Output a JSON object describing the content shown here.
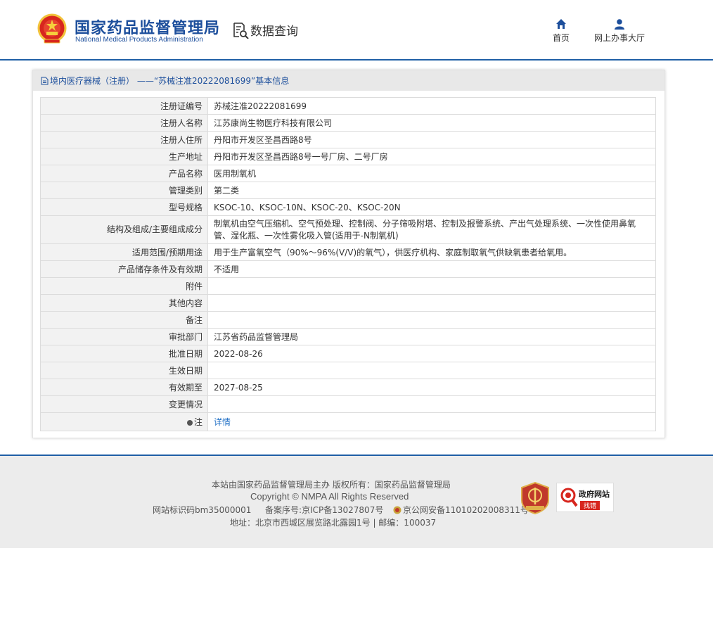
{
  "header": {
    "logo_cn": "国家药品监督管理局",
    "logo_en": "National Medical Products Administration",
    "query_title": "数据查询",
    "nav": [
      {
        "label": "首页",
        "icon": "home-icon"
      },
      {
        "label": "网上办事大厅",
        "icon": "user-icon"
      }
    ]
  },
  "panel": {
    "title": "境内医疗器械（注册） ——“苏械注准20222081699”基本信息",
    "rows": [
      {
        "key": "注册证编号",
        "value": "苏械注准20222081699"
      },
      {
        "key": "注册人名称",
        "value": "江苏康尚生物医疗科技有限公司"
      },
      {
        "key": "注册人住所",
        "value": "丹阳市开发区圣昌西路8号"
      },
      {
        "key": "生产地址",
        "value": "丹阳市开发区圣昌西路8号一号厂房、二号厂房"
      },
      {
        "key": "产品名称",
        "value": "医用制氧机"
      },
      {
        "key": "管理类别",
        "value": "第二类"
      },
      {
        "key": "型号规格",
        "value": "KSOC-10、KSOC-10N、KSOC-20、KSOC-20N"
      },
      {
        "key": "结构及组成/主要组成成分",
        "value": "制氧机由空气压缩机、空气预处理、控制阀、分子筛吸附塔、控制及报警系统、产出气处理系统、一次性使用鼻氧管、湿化瓶、一次性雾化吸入管(适用于-N制氧机)"
      },
      {
        "key": "适用范围/预期用途",
        "value": "用于生产富氧空气（90%～96%(V/V)的氧气），供医疗机构、家庭制取氧气供缺氧患者给氧用。"
      },
      {
        "key": "产品储存条件及有效期",
        "value": "不适用"
      },
      {
        "key": "附件",
        "value": ""
      },
      {
        "key": "其他内容",
        "value": ""
      },
      {
        "key": "备注",
        "value": ""
      },
      {
        "key": "审批部门",
        "value": "江苏省药品监督管理局"
      },
      {
        "key": "批准日期",
        "value": "2022-08-26"
      },
      {
        "key": "生效日期",
        "value": ""
      },
      {
        "key": "有效期至",
        "value": "2027-08-25"
      },
      {
        "key": "变更情况",
        "value": ""
      }
    ],
    "note_key": "注",
    "note_link": "详情"
  },
  "footer": {
    "line1": "本站由国家药品监督管理局主办 版权所有：国家药品监督管理局",
    "line2": "Copyright © NMPA All Rights Reserved",
    "site_id": "网站标识码bm35000001",
    "icp": "备案序号:京ICP备13027807号",
    "police": "京公网安备11010202008311号",
    "address": "地址：北京市西城区展览路北露园1号 | 邮编：100037",
    "badge2_title": "政府网站",
    "badge2_sub": "找错"
  }
}
